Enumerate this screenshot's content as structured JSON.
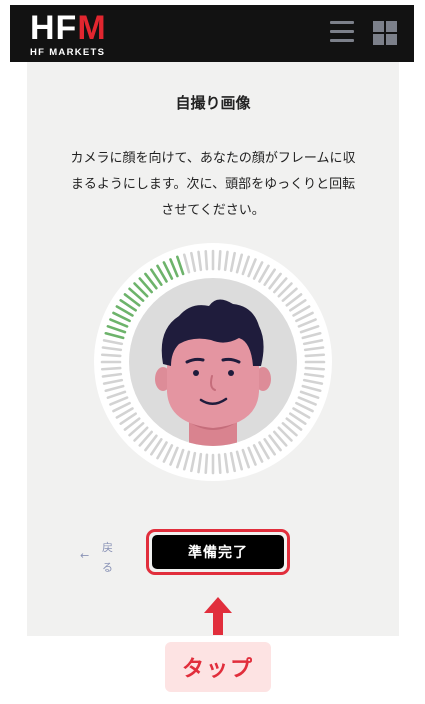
{
  "header": {
    "logo_main_prefix": "HF",
    "logo_main_accent": "M",
    "logo_sub": "HF MARKETS"
  },
  "card": {
    "title": "自撮り画像",
    "instruction": "カメラに顔を向けて、あなたの顔がフレームに収まるようにします。次に、頭部をゆっくりと回転させてください。",
    "progress_fraction": 0.17
  },
  "actions": {
    "back_label": "戻る",
    "ready_label": "準備完了"
  },
  "annotation": {
    "tap_label": "タップ"
  },
  "colors": {
    "header_bg": "#121212",
    "brand_red": "#e1262f",
    "progress_green": "#6db36b",
    "tick_gray": "#d3d3d3",
    "annotation_red": "#e12e3c"
  }
}
